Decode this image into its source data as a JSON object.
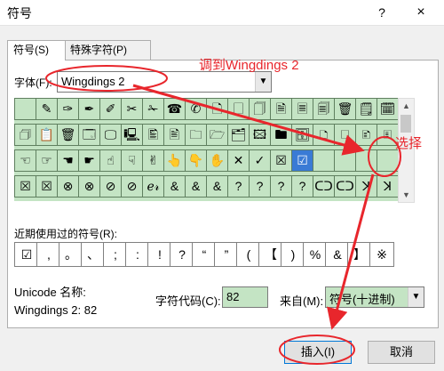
{
  "window": {
    "title": "符号",
    "help": "?",
    "close": "×"
  },
  "tabs": [
    {
      "label": "符号(S)",
      "active": true
    },
    {
      "label": "特殊字符(P)",
      "active": false
    }
  ],
  "font": {
    "label": "字体(F):",
    "value": "Wingdings 2"
  },
  "symbols": [
    [
      "",
      "✎",
      "✑",
      "✒",
      "✐",
      "✂",
      "✁",
      "☎",
      "✆",
      "🗋",
      "🗌",
      "🗍",
      "🗎",
      "🗏",
      "🗐",
      "🗑",
      "🗒",
      "🗓"
    ],
    [
      "🗇",
      "📋",
      "🗑",
      "🗔",
      "🖵",
      "🖳",
      "🖺",
      "🖹",
      "🗀",
      "🗁",
      "🗂",
      "🖾",
      "🖿",
      "🗄",
      "🗅",
      "🗆",
      "🗈",
      "🗉"
    ],
    [
      "☜",
      "☞",
      "☚",
      "☛",
      "☝",
      "☟",
      "✌",
      "👆",
      "👇",
      "✋",
      "✕",
      "✓",
      "☒",
      "☑",
      "",
      "",
      "",
      ""
    ],
    [
      "☒",
      "☒",
      "⊗",
      "⊗",
      "⊘",
      "⊘",
      "ℯ𝓇",
      "&",
      "&",
      "&",
      "?",
      "?",
      "?",
      "?",
      "ᑕᑐ",
      "ᑕᑐ",
      "ꓘ",
      "ꓘ"
    ]
  ],
  "recent": {
    "label": "近期使用过的符号(R):",
    "items": [
      "☑",
      ",",
      "。",
      "、",
      ";",
      ":",
      "!",
      "?",
      "“",
      "”",
      "(",
      "【",
      ")",
      "%",
      "&",
      "】",
      "※"
    ]
  },
  "unicode_name_label": "Unicode 名称:",
  "char_name": "Wingdings 2: 82",
  "char_code": {
    "label": "字符代码(C):",
    "value": "82"
  },
  "from": {
    "label": "来自(M):",
    "value": "符号(十进制)"
  },
  "buttons": {
    "insert": "插入(I)",
    "cancel": "取消"
  },
  "annotations": {
    "font_hint": "调到Wingdings 2",
    "select_hint": "选择"
  },
  "colors": {
    "grid_bg": "#c4e4c4",
    "selection": "#3a7bd5",
    "annotation": "#e8262c"
  },
  "icons": {
    "dropdown": "▼",
    "scroll_up": "▲",
    "scroll_down": "▼"
  }
}
